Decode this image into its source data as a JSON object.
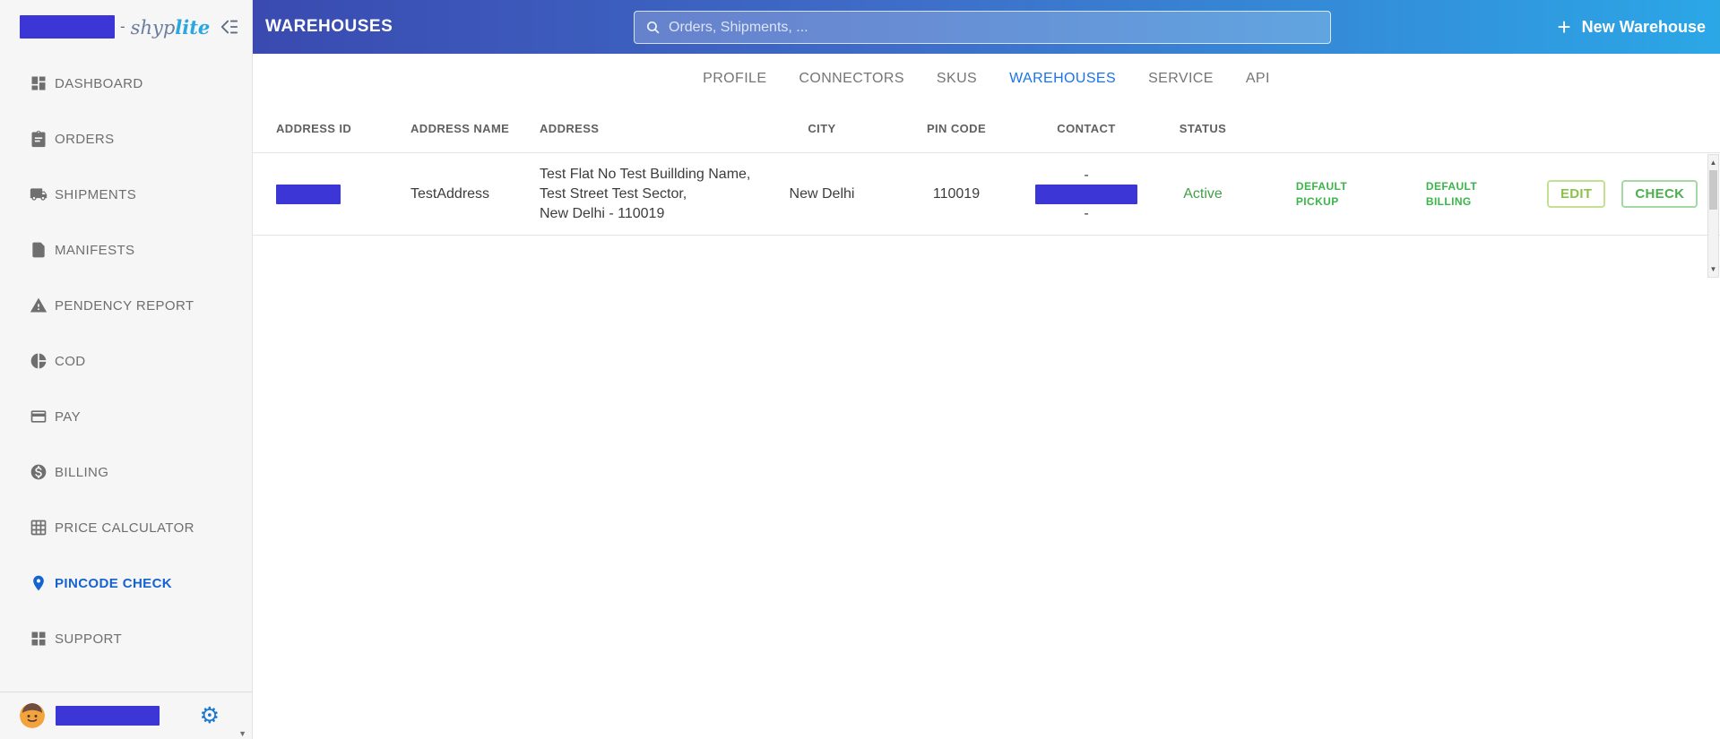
{
  "icons": {
    "plus": "+",
    "gear": "⚙",
    "scroll_up": "▲",
    "scroll_down": "▼",
    "sidebar_scroll_down": "▼",
    "search": "magnifier",
    "collapse": "double-chevron-left"
  },
  "colors": {
    "header_gradient_left": "#3a4ab0",
    "header_gradient_right": "#2ba7e6",
    "active_blue": "#1a73e8",
    "status_green": "#43a047",
    "badge_green": "#3bb54a",
    "edit_green": "#8bc34a",
    "check_green": "#4caf50",
    "redaction_blue": "#3c36d6"
  },
  "sidebar": {
    "logo": {
      "prefix": "-",
      "brand_a": "shyp",
      "brand_b": "lite"
    },
    "items": [
      {
        "label": "DASHBOARD"
      },
      {
        "label": "ORDERS"
      },
      {
        "label": "SHIPMENTS"
      },
      {
        "label": "MANIFESTS"
      },
      {
        "label": "PENDENCY REPORT"
      },
      {
        "label": "COD"
      },
      {
        "label": "PAY"
      },
      {
        "label": "BILLING"
      },
      {
        "label": "PRICE CALCULATOR"
      },
      {
        "label": "PINCODE CHECK",
        "active": true
      },
      {
        "label": "SUPPORT"
      }
    ]
  },
  "header": {
    "title": "WAREHOUSES",
    "search_placeholder": "Orders, Shipments, ...",
    "new_warehouse_label": "New Warehouse"
  },
  "tabs": [
    {
      "label": "PROFILE"
    },
    {
      "label": "CONNECTORS"
    },
    {
      "label": "SKUS"
    },
    {
      "label": "WAREHOUSES",
      "active": true
    },
    {
      "label": "SERVICE"
    },
    {
      "label": "API"
    }
  ],
  "table": {
    "columns": [
      "ADDRESS ID",
      "ADDRESS NAME",
      "ADDRESS",
      "CITY",
      "PIN CODE",
      "CONTACT",
      "STATUS"
    ],
    "row": {
      "address_name": "TestAddress",
      "address_lines": [
        "Test Flat No Test Buillding Name,",
        "Test Street Test Sector,",
        "New Delhi - 110019"
      ],
      "city": "New Delhi",
      "pin_code": "110019",
      "contact_line_top": "-",
      "contact_line_bottom": "-",
      "status": "Active",
      "default_pickup_lines": [
        "DEFAULT",
        "PICKUP"
      ],
      "default_billing_lines": [
        "DEFAULT",
        "BILLING"
      ],
      "edit_label": "EDIT",
      "check_label": "CHECK"
    }
  }
}
